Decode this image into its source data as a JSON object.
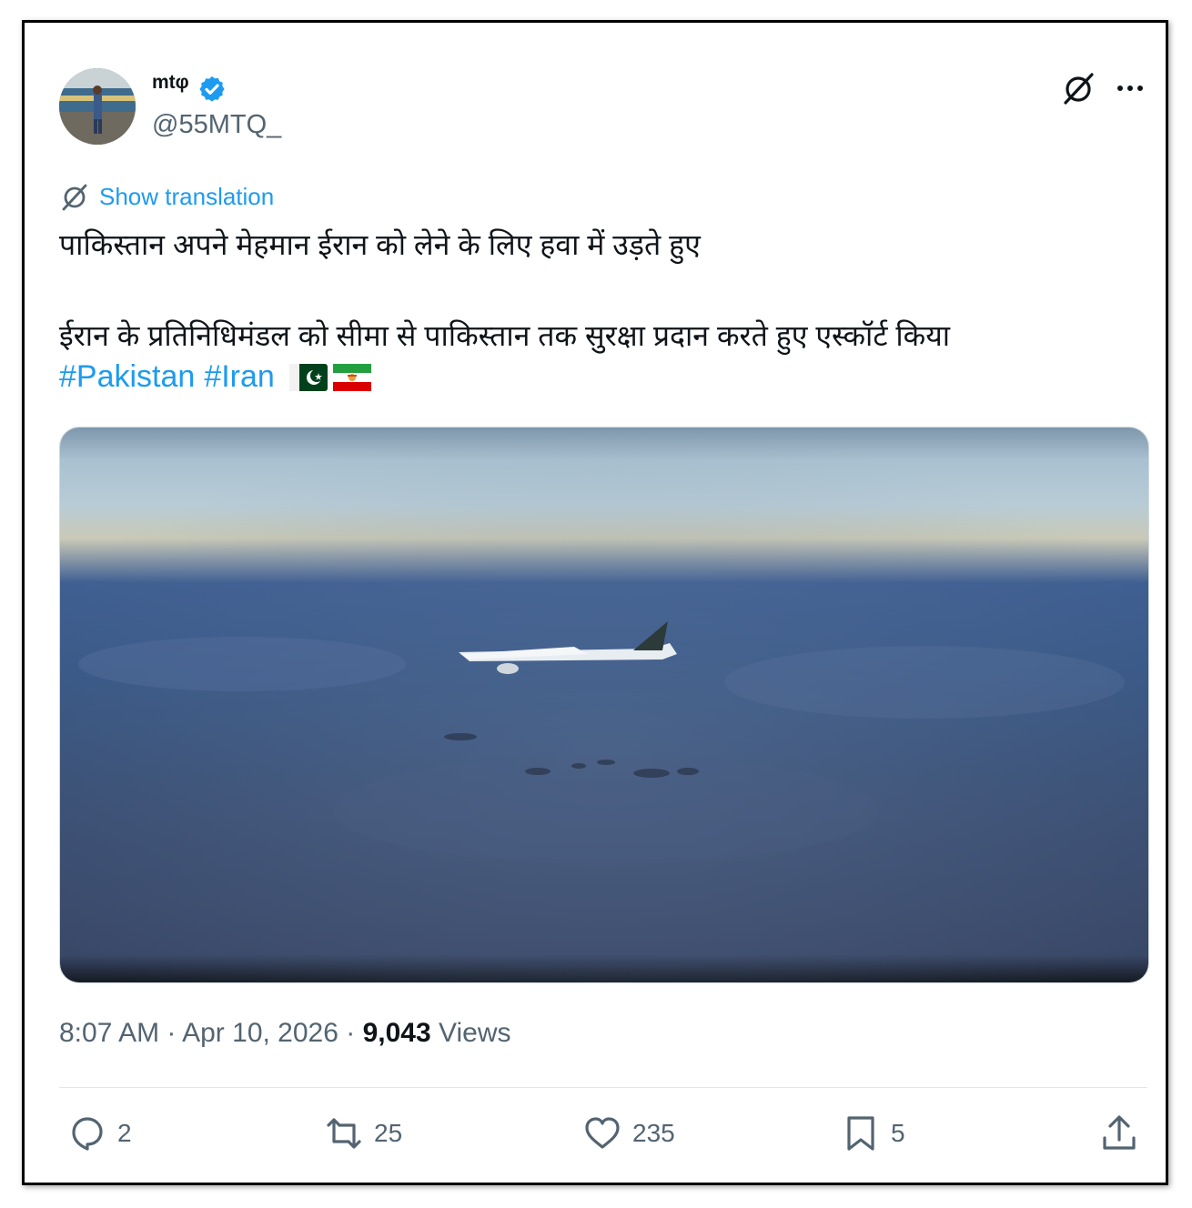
{
  "author": {
    "display_name": "mtφ",
    "handle": "@55MTQ_",
    "verified": true,
    "verified_color": "#1d9bf0"
  },
  "header_icons": [
    "grok-icon",
    "more-icon"
  ],
  "translation": {
    "label": "Show translation",
    "icon": "translate-icon"
  },
  "body": {
    "line1": "पाकिस्तान अपने मेहमान ईरान को लेने के लिए हवा में उड़ते हुए",
    "line2": "ईरान के प्रतिनिधिमंडल को सीमा से पाकिस्तान तक सुरक्षा प्रदान करते हुए एस्कॉर्ट किया",
    "hashtags": [
      "#Pakistan",
      "#Iran"
    ],
    "emoji": [
      "pakistan-flag",
      "iran-flag"
    ]
  },
  "media": {
    "type": "video",
    "description_icon": "airplane-in-sky"
  },
  "meta": {
    "time": "8:07 AM",
    "date": "Apr 10, 2026",
    "separator": "·",
    "views_count": "9,043",
    "views_label": "Views"
  },
  "actions": {
    "replies": "2",
    "reposts": "25",
    "likes": "235",
    "bookmarks": "5"
  },
  "colors": {
    "link": "#1d9bf0",
    "secondary_text": "#536471",
    "primary_text": "#0f1419"
  }
}
